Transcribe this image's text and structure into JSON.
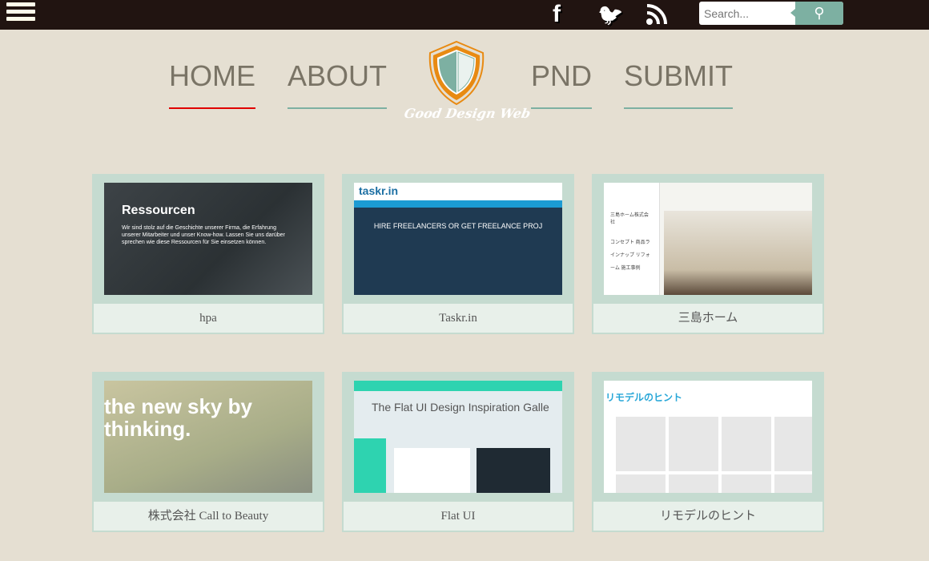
{
  "topbar": {
    "menu_icon": "hamburger-icon",
    "social": [
      {
        "icon": "facebook-icon",
        "glyph": "f"
      },
      {
        "icon": "twitter-icon",
        "glyph": "🐦"
      },
      {
        "icon": "rss-icon",
        "glyph": "◔"
      }
    ],
    "search_placeholder": "Search...",
    "search_icon": "magnifier-icon"
  },
  "nav": {
    "items": [
      {
        "label": "HOME",
        "active": true
      },
      {
        "label": "ABOUT"
      },
      {
        "label": "PND"
      },
      {
        "label": "SUBMIT"
      }
    ],
    "logo_text": "Good Design Web"
  },
  "colors": {
    "topbar": "#211411",
    "background": "#e5dfd2",
    "accent": "#7db0a2",
    "active_underline": "#e00000",
    "logo_orange": "#e88a12"
  },
  "cards": [
    {
      "title": "hpa",
      "thumb": {
        "heading": "Ressourcen",
        "body": "Wir sind stolz auf die Geschichte unserer Firma, die Erfahrung unserer Mitarbeiter und unser Know-how. Lassen Sie uns darüber sprechen wie diese Ressourcen für Sie einsetzen können."
      }
    },
    {
      "title": "Taskr.in",
      "thumb": {
        "heading": "taskr.in",
        "body": "HIRE FREELANCERS OR GET FREELANCE PROJ"
      }
    },
    {
      "title": "三島ホーム",
      "thumb": {
        "heading": "三島ホーム株式会社",
        "body": "コンセプト 商品ラインナップ リフォーム 施工事例"
      }
    },
    {
      "title": "株式会社 Call to Beauty",
      "thumb": {
        "heading": "the new sky by thinking.",
        "body": ""
      }
    },
    {
      "title": "Flat UI",
      "thumb": {
        "heading": "The Flat UI Design Inspiration Galle",
        "body": ""
      }
    },
    {
      "title": "リモデルのヒント",
      "thumb": {
        "heading": "リモデルのヒント",
        "body": ""
      }
    }
  ]
}
